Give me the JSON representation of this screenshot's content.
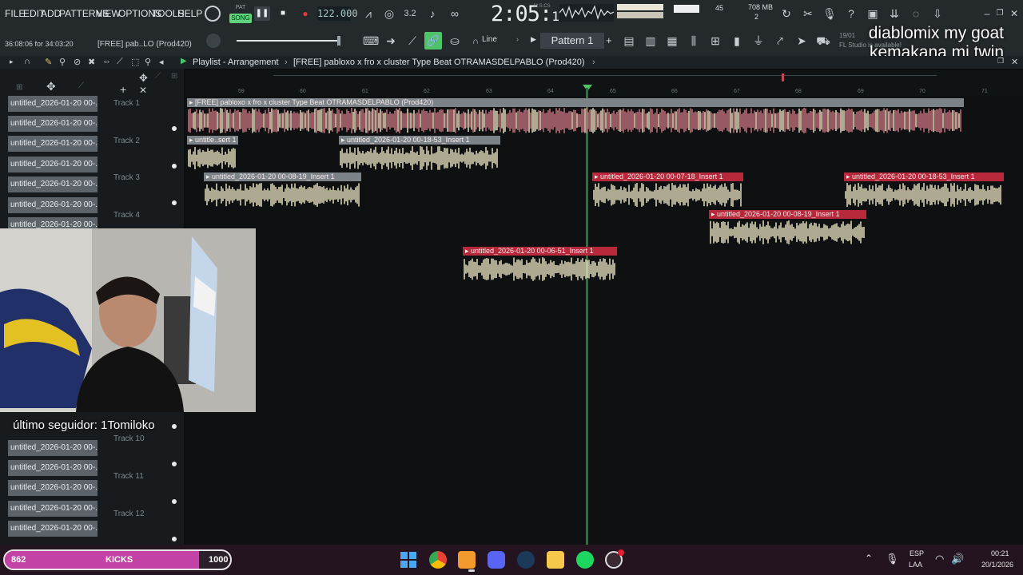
{
  "menu": [
    "FILE",
    "EDIT",
    "ADD",
    "PATTERNS",
    "VIEW",
    "OPTIONS",
    "TOOLS",
    "HELP"
  ],
  "transport": {
    "pat_label": "PAT",
    "song_label": "SONG",
    "bpm": "122.000",
    "time_main": "2:05",
    "time_sub": "17",
    "mcs_label": "M:S:CS",
    "cpu_mem": "708 MB",
    "cpu_val": "45",
    "cpu_poly": "2"
  },
  "hint_bar": {
    "timecode": "36:08:06 for 34:03:20",
    "hint": "[FREE] pab..LO  (Prod420)"
  },
  "toolbar2": {
    "snap_mode": "Line",
    "pattern": "Pattern 1",
    "news_date": "19/01",
    "news_text": "FL Studio is available!"
  },
  "overlay_text": [
    "diablomix my goat",
    "kemakana mi twin"
  ],
  "playlist": {
    "breadcrumb": "Playlist - Arrangement",
    "song_title": "[FREE] pabloxo x fro x cluster  Type Beat  OTRAMASDELPABLO  (Prod420)"
  },
  "ruler": [
    "59",
    "60",
    "61",
    "62",
    "63",
    "64",
    "65",
    "66",
    "67",
    "68",
    "69",
    "70",
    "71"
  ],
  "picker_clip": "untitled_2026-01-20 00-...",
  "tracks_top": [
    "Track 1",
    "Track 2",
    "Track 3",
    "Track 4"
  ],
  "tracks_bottom": [
    "Track 10",
    "Track 11",
    "Track 12"
  ],
  "clips": [
    {
      "label": "[FREE] pabloxo x fro x cluster  Type Beat  OTRAMASDELPABLO  (Prod420)",
      "color": "#7c8388"
    },
    {
      "label": "untitle..sert 1",
      "color": "#7c8388"
    },
    {
      "label": "untitled_2026-01-20 00-18-53_Insert 1",
      "color": "#7c8388"
    },
    {
      "label": "untitled_2026-01-20 00-08-19_Insert 1",
      "color": "#7c8388"
    },
    {
      "label": "untitled_2026-01-20 00-07-18_Insert 1",
      "color": "#b8283b"
    },
    {
      "label": "untitled_2026-01-20 00-18-53_Insert 1",
      "color": "#b8283b"
    },
    {
      "label": "untitled_2026-01-20 00-08-19_Insert 1",
      "color": "#b8283b"
    },
    {
      "label": "untitled_2026-01-20 00-06-51_Insert 1",
      "color": "#b8283b"
    }
  ],
  "stream": {
    "follower_text": "último seguidor: 1Tomiloko",
    "goal_current": "862",
    "goal_label": "KICKS",
    "goal_target": "1000",
    "goal_fraction": 0.862
  },
  "taskbar": {
    "lang1": "ESP",
    "lang2": "LAA",
    "time": "00:21",
    "date": "20/1/2026"
  },
  "colors": {
    "accent_green": "#4fc36a",
    "clip_red": "#b8283b",
    "wave_cream": "#f3edc9",
    "wave_red": "#d27a86"
  }
}
